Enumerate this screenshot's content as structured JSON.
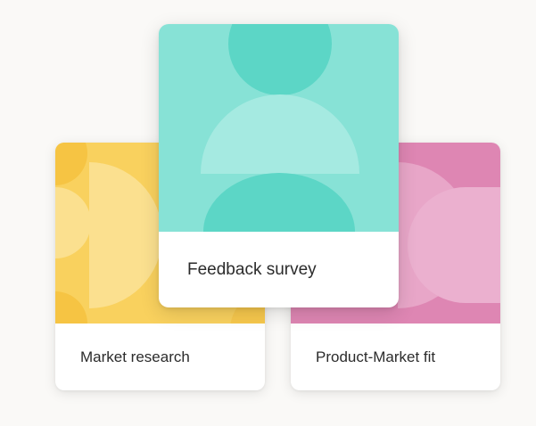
{
  "templates": {
    "market_research": {
      "label": "Market research",
      "color": "#f9d15e",
      "accent": "#fbe08f"
    },
    "feedback_survey": {
      "label": "Feedback survey",
      "color": "#87e2d6",
      "accent": "#5cd6c6"
    },
    "product_market_fit": {
      "label": "Product-Market fit",
      "color": "#de86b3",
      "accent": "#ebb0cf"
    }
  }
}
